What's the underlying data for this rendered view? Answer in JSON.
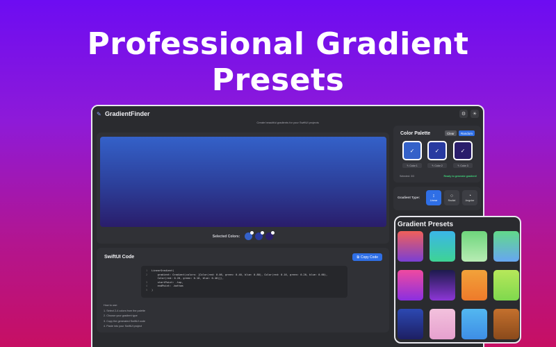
{
  "headline": {
    "line1": "Professional Gradient",
    "line2": "Presets"
  },
  "app": {
    "title": "GradientFinder",
    "subtitle": "Create beautiful gradients for your SwiftUI projects",
    "icons": {
      "app": "pencil-icon",
      "settings": "gear-icon",
      "theme": "sun-icon"
    }
  },
  "preview": {
    "selected_label": "Selected Colors:",
    "selected_colors": [
      "#3461c9",
      "#283aa0",
      "#2a1d6b"
    ]
  },
  "code": {
    "title": "SwiftUI Code",
    "copy_label": "Copy Code",
    "lines": [
      {
        "n": "1",
        "text": "LinearGradient("
      },
      {
        "n": "2",
        "text": "    gradient: Gradient(colors: [Color(red: 0.06, green: 0.40, blue: 0.80), Color(red: 0.16, green: 0.20, blue: 0.60),"
      },
      {
        "n": "",
        "text": "    Color(red: 0.20, green: 0.10, blue: 0.40)]),"
      },
      {
        "n": "3",
        "text": "    startPoint: .top,"
      },
      {
        "n": "4",
        "text": "    endPoint: .bottom"
      },
      {
        "n": "5",
        "text": ")"
      }
    ],
    "howto_title": "How to use:",
    "howto_steps": [
      "1. Select 2-4 colors from the palette",
      "2. Choose your gradient type",
      "3. Copy the generated SwiftUI code",
      "4. Paste into your SwiftUI project"
    ]
  },
  "palette": {
    "title": "Color Palette",
    "clear_label": "Clear",
    "random_label": "Random",
    "swatches": [
      {
        "label": "Color 1",
        "color": "#3461c9"
      },
      {
        "label": "Color 2",
        "color": "#283aa0"
      },
      {
        "label": "Color 3",
        "color": "#2a1d6b"
      }
    ],
    "selected_info": "Selected: 3/3",
    "status": "Ready to generate gradient!"
  },
  "gradient_type": {
    "label": "Gradient Type:",
    "options": [
      {
        "label": "Linear",
        "icon": "arrows-vertical-icon",
        "active": true
      },
      {
        "label": "Radial",
        "icon": "circle-icon",
        "active": false
      },
      {
        "label": "Angular",
        "icon": "angular-icon",
        "active": false
      }
    ]
  },
  "presets": {
    "title": "Gradient Presets",
    "items": [
      {
        "from": "#f0605a",
        "to": "#7a3fd4"
      },
      {
        "from": "#3bb6e8",
        "to": "#3ed394"
      },
      {
        "from": "#6ed67c",
        "to": "#b8ecb4"
      },
      {
        "from": "#62d98a",
        "to": "#67a6f2"
      },
      {
        "from": "#ef4aa0",
        "to": "#8a2fe0"
      },
      {
        "from": "#1d1b4d",
        "to": "#8d36d6"
      },
      {
        "from": "#f2a23a",
        "to": "#ee7a2a"
      },
      {
        "from": "#b7e85a",
        "to": "#7fd84e"
      },
      {
        "from": "#2c48b2",
        "to": "#1d1f63"
      },
      {
        "from": "#f3c1dd",
        "to": "#e6a0ce"
      },
      {
        "from": "#53b7f0",
        "to": "#3e8ee6"
      },
      {
        "from": "#c4702d",
        "to": "#8a4a1b"
      }
    ]
  }
}
